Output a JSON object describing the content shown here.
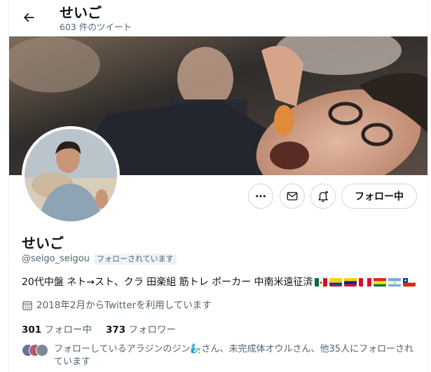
{
  "header": {
    "name": "せいご",
    "tweet_count": "603 件のツイート"
  },
  "profile": {
    "name": "せいご",
    "handle": "@seigo_seigou",
    "follows_you": "フォローされています",
    "bio": "20代中盤 ネト→スト、クラ 田楽組 筋トレ ポーカー 中南米遠征済",
    "flags": [
      "mexico-flag",
      "colombia-flag",
      "venezuela-flag",
      "peru-flag",
      "bolivia-flag",
      "argentina-flag",
      "chile-flag"
    ],
    "joined": "2018年2月からTwitterを利用しています",
    "following_count": "301",
    "following_label": "フォロー中",
    "followers_count": "373",
    "followers_label": "フォロワー",
    "known_followers": "フォローしているアラジンのジン🧞‍♂️さん、未完成体オウルさん、他35人にフォローされています"
  },
  "actions": {
    "follow_label": "フォロー中"
  },
  "icons": [
    "back-arrow-icon",
    "more-icon",
    "message-icon",
    "notify-bell-icon",
    "calendar-icon"
  ],
  "colors": {
    "text": "#0f1419",
    "secondary": "#536471",
    "border": "#cfd9de"
  }
}
